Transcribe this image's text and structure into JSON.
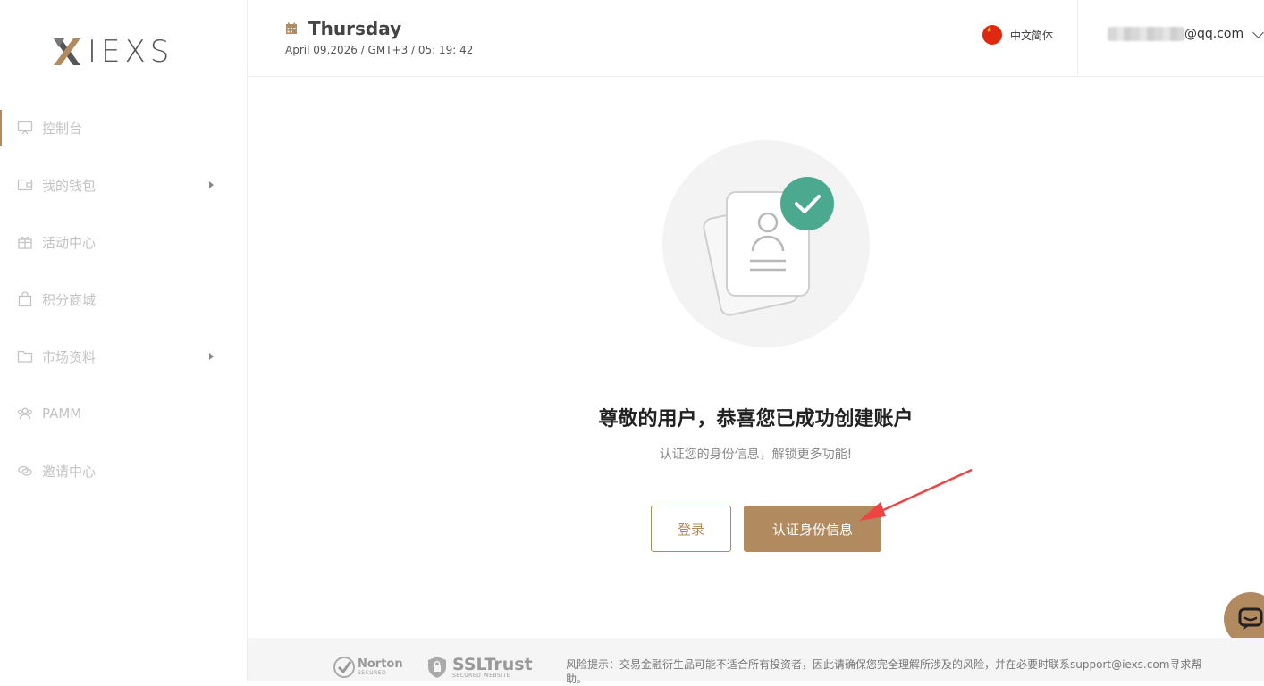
{
  "brand": {
    "logo_text": "IEXS",
    "accent_color": "#b28a5f"
  },
  "sidebar": {
    "items": [
      {
        "label": "控制台",
        "icon": "monitor-icon",
        "active": true,
        "has_submenu": false
      },
      {
        "label": "我的钱包",
        "icon": "wallet-icon",
        "active": false,
        "has_submenu": true
      },
      {
        "label": "活动中心",
        "icon": "gift-icon",
        "active": false,
        "has_submenu": false
      },
      {
        "label": "积分商城",
        "icon": "shopping-bag-icon",
        "active": false,
        "has_submenu": false
      },
      {
        "label": "市场资料",
        "icon": "folder-icon",
        "active": false,
        "has_submenu": true
      },
      {
        "label": "PAMM",
        "icon": "users-icon",
        "active": false,
        "has_submenu": false
      },
      {
        "label": "邀请中心",
        "icon": "link-icon",
        "active": false,
        "has_submenu": false
      }
    ]
  },
  "header": {
    "day": "Thursday",
    "date_line": "April 09,2026 / GMT+3 / 05: 19: 42",
    "language": "中文简体",
    "email_suffix": "@qq.com"
  },
  "main": {
    "headline": "尊敬的用户，恭喜您已成功创建账户",
    "subtitle": "认证您的身份信息，解锁更多功能!",
    "login_button": "登录",
    "verify_button": "认证身份信息"
  },
  "footer": {
    "norton_name": "Norton",
    "norton_sub": "SECURED",
    "ssl_name": "SSLTrust",
    "ssl_sub": "SECURED WEBSITE",
    "risk_text": "风险提示：交易金融衍生品可能不适合所有投资者，因此请确保您完全理解所涉及的风险，并在必要时联系support@iexs.com寻求帮助。"
  }
}
